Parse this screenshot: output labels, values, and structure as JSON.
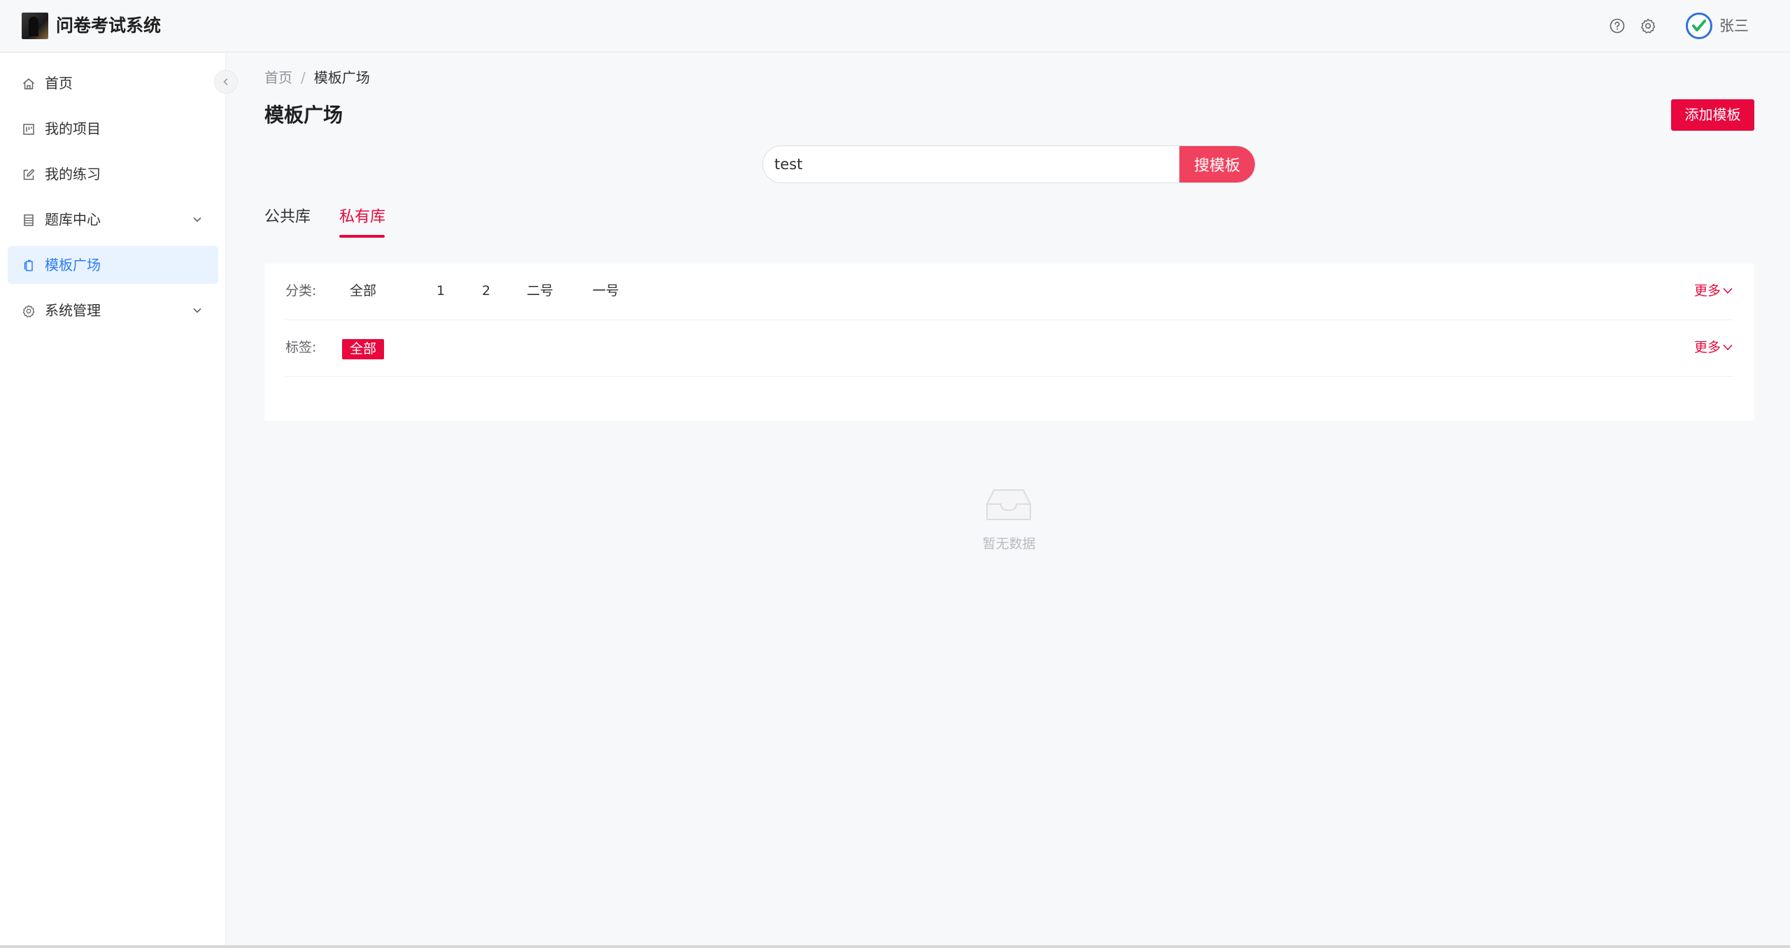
{
  "app": {
    "title": "问卷考试系统",
    "username": "张三"
  },
  "header": {
    "icons": [
      "help-icon",
      "settings-icon"
    ]
  },
  "sidebar": {
    "items": [
      {
        "label": "首页",
        "icon": "home-icon"
      },
      {
        "label": "我的项目",
        "icon": "project-icon"
      },
      {
        "label": "我的练习",
        "icon": "edit-icon"
      },
      {
        "label": "题库中心",
        "icon": "list-icon",
        "expandable": true
      },
      {
        "label": "模板广场",
        "icon": "template-icon",
        "active": true
      },
      {
        "label": "系统管理",
        "icon": "gear-icon",
        "expandable": true
      }
    ]
  },
  "breadcrumb": {
    "home": "首页",
    "separator": "/",
    "current": "模板广场"
  },
  "page": {
    "title": "模板广场",
    "add_button": "添加模板"
  },
  "search": {
    "value": "test",
    "button": "搜模板"
  },
  "tabs": [
    {
      "label": "公共库"
    },
    {
      "label": "私有库",
      "active": true
    }
  ],
  "filters": {
    "category_label": "分类:",
    "categories": [
      "全部",
      "1",
      "2",
      "二号",
      "一号"
    ],
    "tag_label": "标签:",
    "tags": [
      "全部"
    ],
    "more": "更多"
  },
  "empty": {
    "text": "暂无数据"
  },
  "colors": {
    "accent": "#e8083e",
    "active_menu_bg": "#e8f3ff",
    "active_menu_text": "#2f7cf6",
    "search_button": "#f0425e"
  }
}
